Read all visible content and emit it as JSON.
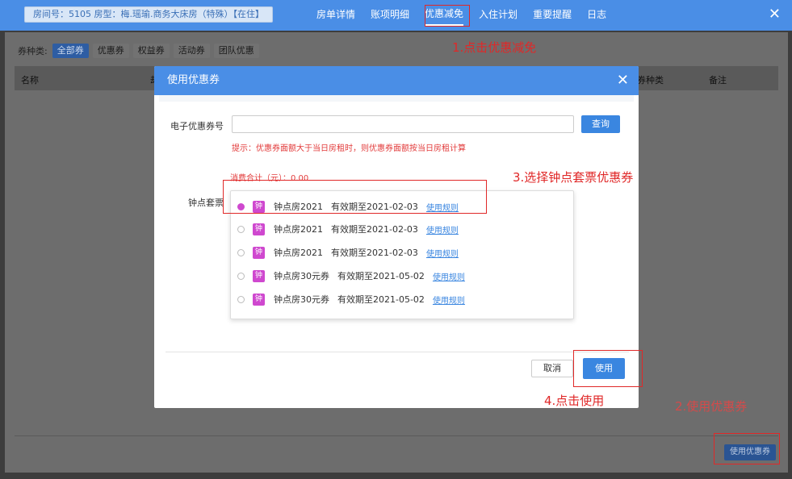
{
  "header": {
    "room_info": "房间号：5105 房型：梅.瑶瑜.商务大床房（特殊）【在住】",
    "tabs": [
      {
        "label": "房单详情",
        "active": false
      },
      {
        "label": "账项明细",
        "active": false
      },
      {
        "label": "优惠减免",
        "active": true
      },
      {
        "label": "入住计划",
        "active": false
      },
      {
        "label": "重要提醒",
        "active": false
      },
      {
        "label": "日志",
        "active": false
      }
    ],
    "close_glyph": "✕"
  },
  "panel": {
    "filter_label": "券种类:",
    "filters": [
      {
        "label": "全部券",
        "active": true
      },
      {
        "label": "优惠券",
        "active": false
      },
      {
        "label": "权益券",
        "active": false
      },
      {
        "label": "活动券",
        "active": false
      },
      {
        "label": "团队优惠",
        "active": false
      }
    ],
    "columns": {
      "name": "名称",
      "col2": "劫",
      "type": "券种类",
      "note": "备注"
    },
    "use_coupon_button": "使用优惠券"
  },
  "modal": {
    "title": "使用优惠券",
    "close_glyph": "✕",
    "code_label": "电子优惠券号",
    "code_value": "",
    "code_placeholder": "",
    "query_button": "查询",
    "hint": "提示：优惠券面额大于当日房租时，则优惠券面额按当日房租计算",
    "total": "消费合计（元）：0.00",
    "ticket_label": "钟点套票",
    "badge": "钟",
    "rule_link": "使用规则",
    "options": [
      {
        "name": "钟点房2021",
        "valid": "有效期至2021-02-03",
        "checked": true
      },
      {
        "name": "钟点房2021",
        "valid": "有效期至2021-02-03",
        "checked": false
      },
      {
        "name": "钟点房2021",
        "valid": "有效期至2021-02-03",
        "checked": false
      },
      {
        "name": "钟点房30元券",
        "valid": "有效期至2021-05-02",
        "checked": false
      },
      {
        "name": "钟点房30元券",
        "valid": "有效期至2021-05-02",
        "checked": false
      }
    ],
    "cancel_button": "取消",
    "use_button": "使用"
  },
  "annotations": {
    "step1": "1.点击优惠减免",
    "step2": "2.使用优惠券",
    "step3": "3.选择钟点套票优惠券",
    "step4": "4.点击使用"
  },
  "colors": {
    "header_blue": "#4a8ee6",
    "primary_button": "#3a86e0",
    "annotation_red": "#e02828",
    "badge_magenta": "#cf48cf"
  }
}
